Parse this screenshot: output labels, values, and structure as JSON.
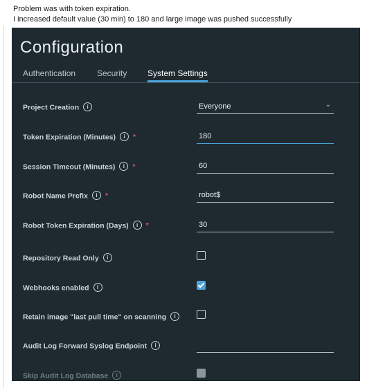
{
  "note": {
    "line1": "Problem was with token expiration.",
    "line2": "I increased default value (30 min) to 180 and large image was pushed successfully"
  },
  "page": {
    "title": "Configuration",
    "tabs": [
      {
        "label": "Authentication",
        "active": false
      },
      {
        "label": "Security",
        "active": false
      },
      {
        "label": "System Settings",
        "active": true
      }
    ]
  },
  "settings": {
    "project_creation": {
      "label": "Project Creation",
      "value": "Everyone"
    },
    "token_expiration": {
      "label": "Token Expiration (Minutes)",
      "value": "180",
      "required": true
    },
    "session_timeout": {
      "label": "Session Timeout (Minutes)",
      "value": "60",
      "required": true
    },
    "robot_name_prefix": {
      "label": "Robot Name Prefix",
      "value": "robot$",
      "required": true
    },
    "robot_token_expiration": {
      "label": "Robot Token Expiration (Days)",
      "value": "30",
      "required": true
    },
    "repository_read_only": {
      "label": "Repository Read Only",
      "checked": false
    },
    "webhooks_enabled": {
      "label": "Webhooks enabled",
      "checked": true
    },
    "retain_image_pull_time": {
      "label": "Retain image \"last pull time\" on scanning",
      "checked": false
    },
    "audit_log_forward_endpoint": {
      "label": "Audit Log Forward Syslog Endpoint",
      "value": ""
    },
    "skip_audit_log_database": {
      "label": "Skip Audit Log Database",
      "checked": true,
      "disabled": true
    }
  },
  "icons": {
    "info": "info-circle-icon",
    "dropdown": "chevron-down-icon",
    "info_glyph": "i",
    "required_glyph": "*",
    "chevron_glyph": "⌄"
  },
  "colors": {
    "panel_bg": "#1f2a30",
    "accent": "#4aa3d8",
    "required": "#e0525b"
  }
}
